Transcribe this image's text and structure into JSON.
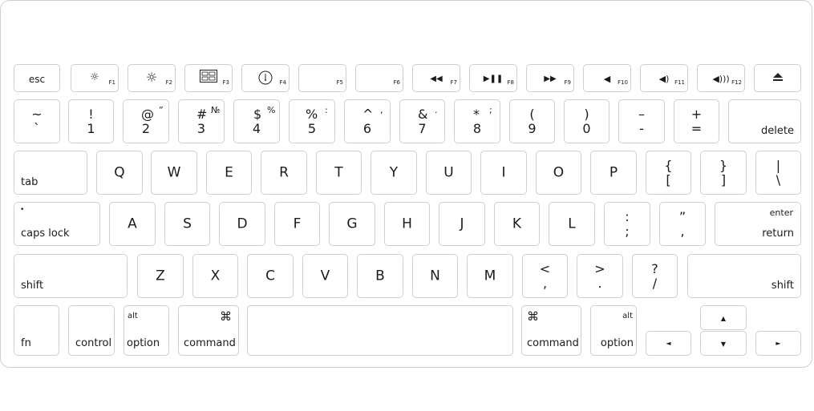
{
  "function_row": {
    "esc": "esc",
    "f1": "F1",
    "f2": "F2",
    "f3": "F3",
    "f4": "F4",
    "f5": "F5",
    "f6": "F6",
    "f7": "F7",
    "f8": "F8",
    "f9": "F9",
    "f10": "F10",
    "f11": "F11",
    "f12": "F12",
    "icons": {
      "f1": "brightness-down-icon",
      "f2": "brightness-up-icon",
      "f3": "mission-control-icon",
      "f4": "dashboard-icon",
      "f7": "rewind-icon",
      "f8": "play-pause-icon",
      "f9": "fast-forward-icon",
      "f10": "mute-icon",
      "f11": "volume-down-icon",
      "f12": "volume-up-icon",
      "eject": "eject-icon"
    }
  },
  "number_row": {
    "tilde": {
      "upper": "~",
      "lower": "`"
    },
    "one": {
      "upper": "!",
      "lower": "1"
    },
    "two": {
      "upper": "@",
      "alt": "”",
      "lower": "2"
    },
    "three": {
      "upper": "#",
      "alt": "№",
      "lower": "3"
    },
    "four": {
      "upper": "$",
      "alt": "%",
      "lower": "4"
    },
    "five": {
      "upper": "%",
      "alt": ":",
      "lower": "5"
    },
    "six": {
      "upper": "^",
      "alt": ",",
      "lower": "6"
    },
    "seven": {
      "upper": "&",
      "alt": ".",
      "lower": "7"
    },
    "eight": {
      "upper": "*",
      "alt": ";",
      "lower": "8"
    },
    "nine": {
      "upper": "(",
      "lower": "9"
    },
    "zero": {
      "upper": ")",
      "lower": "0"
    },
    "minus": {
      "upper": "–",
      "lower": "-"
    },
    "equals": {
      "upper": "+",
      "lower": "="
    },
    "delete": "delete"
  },
  "qwerty_row": {
    "tab": "tab",
    "letters": [
      "Q",
      "W",
      "E",
      "R",
      "T",
      "Y",
      "U",
      "I",
      "O",
      "P"
    ],
    "lbracket": {
      "upper": "{",
      "lower": "["
    },
    "rbracket": {
      "upper": "}",
      "lower": "]"
    },
    "backslash": {
      "upper": "|",
      "lower": "\\"
    }
  },
  "home_row": {
    "capslock": "caps lock",
    "capslock_dot": "•",
    "letters": [
      "A",
      "S",
      "D",
      "F",
      "G",
      "H",
      "J",
      "K",
      "L"
    ],
    "semicolon": {
      "upper": ":",
      "lower": ";"
    },
    "quote": {
      "upper": "”",
      "lower": ","
    },
    "enter": "enter",
    "return": "return"
  },
  "bottom_letter_row": {
    "lshift": "shift",
    "letters": [
      "Z",
      "X",
      "C",
      "V",
      "B",
      "N",
      "M"
    ],
    "comma": {
      "upper": "<",
      "lower": ","
    },
    "period": {
      "upper": ">",
      "lower": "."
    },
    "slash": {
      "upper": "?",
      "lower": "/"
    },
    "rshift": "shift"
  },
  "modifier_row": {
    "fn": "fn",
    "control": "control",
    "alt": "alt",
    "option": "option",
    "command_symbol": "⌘",
    "command": "command",
    "arrows": {
      "up": "▲",
      "down": "▼",
      "left": "◄",
      "right": "►"
    }
  }
}
